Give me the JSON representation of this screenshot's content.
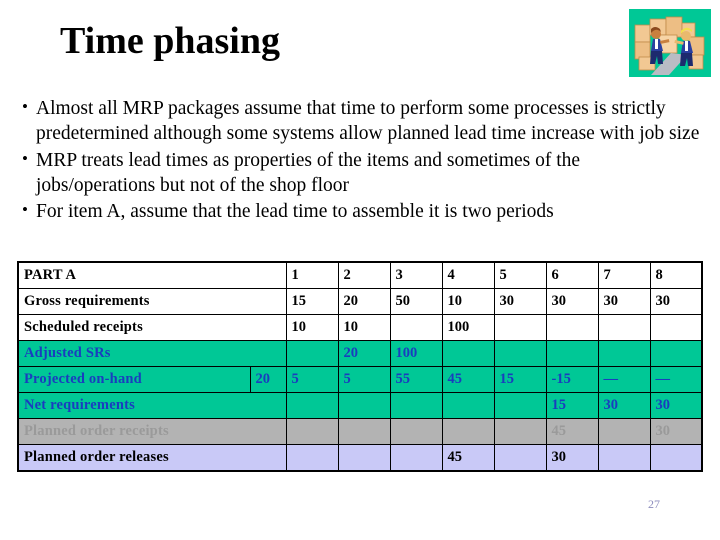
{
  "slide": {
    "title": "Time phasing",
    "page_number": "27",
    "clipart_name": "warehouse-workers-boxes-clipart",
    "clipart_background_color": "#00C896"
  },
  "bullets": [
    {
      "marker": "•",
      "text": "Almost all MRP packages assume that time to perform some processes is strictly predetermined although some systems allow planned lead time increase with job size"
    },
    {
      "marker": "•",
      "text": "MRP treats lead times as properties of the items and sometimes of the jobs/operations but not of the shop floor"
    },
    {
      "marker": "•",
      "text": "For item A, assume that the lead time to assemble it is two periods"
    }
  ],
  "colors": {
    "green_row": "#00C896",
    "green_text": "#1A3DBF",
    "gray_row": "#B3B3B3",
    "gray_text": "#9A9A9A",
    "lavender_row": "#C9C9F7",
    "black_text": "#000000"
  },
  "table": {
    "periods": [
      "1",
      "2",
      "3",
      "4",
      "5",
      "6",
      "7",
      "8"
    ],
    "header_label": "PART A",
    "rows": [
      {
        "label": "Gross requirements",
        "style": "white",
        "onhand": "",
        "values": [
          "15",
          "20",
          "50",
          "10",
          "30",
          "30",
          "30",
          "30"
        ]
      },
      {
        "label": "Scheduled receipts",
        "style": "white",
        "onhand": "",
        "values": [
          "10",
          "10",
          "",
          "100",
          "",
          "",
          "",
          ""
        ]
      },
      {
        "label": "Adjusted SRs",
        "style": "green",
        "onhand": "",
        "values": [
          "",
          "20",
          "100",
          "",
          "",
          "",
          "",
          ""
        ]
      },
      {
        "label": "Projected on-hand",
        "style": "green",
        "onhand": "20",
        "values": [
          "5",
          "5",
          "55",
          "45",
          "15",
          "-15",
          "—",
          "—"
        ]
      },
      {
        "label": "Net requirements",
        "style": "green",
        "onhand": "",
        "values": [
          "",
          "",
          "",
          "",
          "",
          "15",
          "30",
          "30"
        ]
      },
      {
        "label": "Planned order receipts",
        "style": "gray",
        "onhand": "",
        "values": [
          "",
          "",
          "",
          "",
          "",
          "45",
          "",
          "30"
        ]
      },
      {
        "label": "Planned order releases",
        "style": "lavender",
        "onhand": "",
        "values": [
          "",
          "",
          "",
          "45",
          "",
          "30",
          "",
          ""
        ]
      }
    ]
  }
}
